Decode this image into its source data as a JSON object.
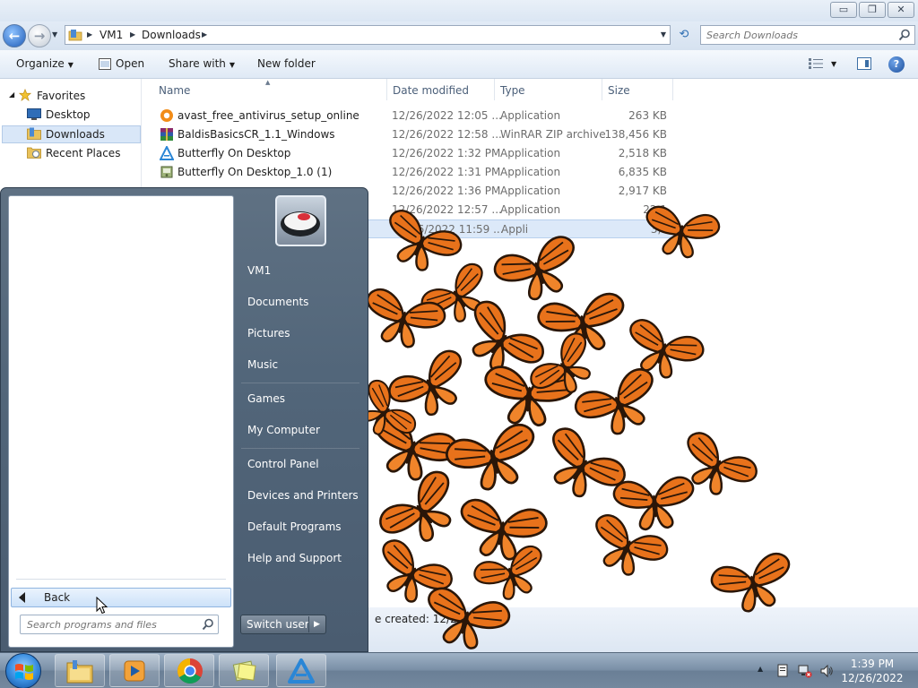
{
  "explorer": {
    "caption_buttons": {
      "minimize": "▭",
      "maximize": "❐",
      "close": "✕"
    },
    "breadcrumb": [
      "VM1",
      "Downloads"
    ],
    "search_placeholder": "Search Downloads",
    "toolbar": {
      "organize": "Organize",
      "open": "Open",
      "share_with": "Share with",
      "new_folder": "New folder"
    },
    "nav_pane": {
      "favorites": "Favorites",
      "desktop": "Desktop",
      "downloads": "Downloads",
      "recent_places": "Recent Places"
    },
    "columns": {
      "name": "Name",
      "date_modified": "Date modified",
      "type": "Type",
      "size": "Size"
    },
    "files": [
      {
        "name": "avast_free_antivirus_setup_online",
        "date": "12/26/2022 12:05 ...",
        "type": "Application",
        "size": "263 KB",
        "icon": "avast-icon"
      },
      {
        "name": "BaldisBasicsCR_1.1_Windows",
        "date": "12/26/2022 12:58 ...",
        "type": "WinRAR ZIP archive",
        "size": "138,456 KB",
        "icon": "winrar-icon"
      },
      {
        "name": "Butterfly On Desktop",
        "date": "12/26/2022 1:32 PM",
        "type": "Application",
        "size": "2,518 KB",
        "icon": "butterfly-app-icon"
      },
      {
        "name": "Butterfly On Desktop_1.0 (1)",
        "date": "12/26/2022 1:31 PM",
        "type": "Application",
        "size": "6,835 KB",
        "icon": "installer-icon"
      },
      {
        "name": "",
        "date": "12/26/2022 1:36 PM",
        "type": "Application",
        "size": "2,917 KB",
        "icon": "application-icon"
      },
      {
        "name": "",
        "date": "12/26/2022 12:57 ...",
        "type": "Application",
        "size": "22,1",
        "icon": "application-icon"
      },
      {
        "name": "",
        "date": "/26/2022 11:59 ...",
        "type": "Appli",
        "size": "3,3",
        "icon": "application-icon"
      }
    ],
    "details_created": "e created: 12/2"
  },
  "start_menu": {
    "back_label": "Back",
    "search_placeholder": "Search programs and files",
    "right_links": [
      "VM1",
      "Documents",
      "Pictures",
      "Music",
      "Games",
      "My Computer",
      "Control Panel",
      "Devices and Printers",
      "Default Programs",
      "Help and Support"
    ],
    "switch_user_label": "Switch user"
  },
  "taskbar": {
    "pinned": [
      "explorer-icon",
      "media-player-icon",
      "chrome-icon",
      "notes-icon",
      "butterfly-app-icon"
    ],
    "tray_icons": [
      "action-center-icon",
      "network-icon",
      "volume-icon"
    ],
    "clock_time": "1:39 PM",
    "clock_date": "12/26/2022"
  },
  "colors": {
    "start_menu_bg": "#52667a",
    "selection": "#dce9f9",
    "butterfly_orange": "#e8721b",
    "butterfly_black": "#2a1608"
  }
}
